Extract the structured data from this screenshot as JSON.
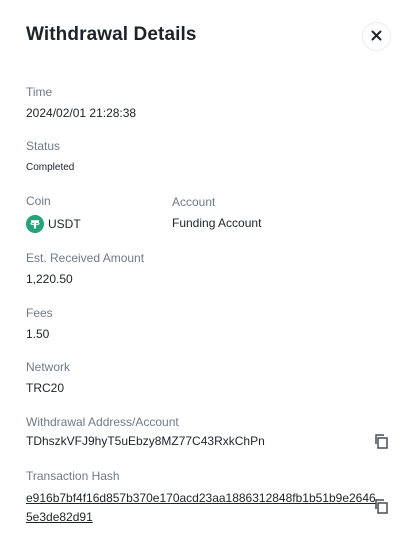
{
  "modal": {
    "title": "Withdrawal Details"
  },
  "fields": {
    "time_label": "Time",
    "time_value": "2024/02/01 21:28:38",
    "status_label": "Status",
    "status_value": "Completed",
    "coin_label": "Coin",
    "coin_value": "USDT",
    "account_label": "Account",
    "account_value": "Funding Account",
    "received_label": "Est. Received Amount",
    "received_value": "1,220.50",
    "fees_label": "Fees",
    "fees_value": "1.50",
    "network_label": "Network",
    "network_value": "TRC20",
    "address_label": "Withdrawal Address/Account",
    "address_value": "TDhszkVFJ9hyT5uEbzy8MZ77C43RxkChPn",
    "hash_label": "Transaction Hash",
    "hash_value": "e916b7bf4f16d857b370e170acd23aa1886312848fb1b51b9e26465e3de82d91"
  },
  "icons": {
    "close": "close-icon",
    "coin": "tether-icon",
    "copy_address": "copy-icon",
    "copy_hash": "copy-icon"
  },
  "colors": {
    "text_primary": "#1e2329",
    "text_secondary": "#707a8a",
    "tether_green": "#26a17b",
    "border": "#eaecef"
  }
}
